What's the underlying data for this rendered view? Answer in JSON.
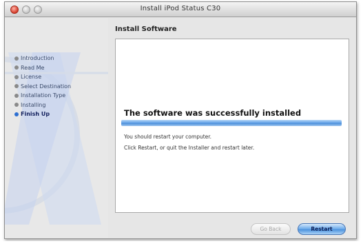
{
  "window": {
    "title": "Install iPod Status C30"
  },
  "sidebar": {
    "steps": [
      {
        "label": "Introduction",
        "state": "done"
      },
      {
        "label": "Read Me",
        "state": "done"
      },
      {
        "label": "License",
        "state": "done"
      },
      {
        "label": "Select Destination",
        "state": "done"
      },
      {
        "label": "Installation Type",
        "state": "done"
      },
      {
        "label": "Installing",
        "state": "done"
      },
      {
        "label": "Finish Up",
        "state": "current"
      }
    ]
  },
  "main": {
    "heading": "Install Software",
    "success_title": "The software was successfully installed",
    "progress_percent": 100,
    "note_line1": "You should restart your computer.",
    "note_line2": "Click Restart, or quit the Installer and restart later."
  },
  "buttons": {
    "go_back": "Go Back",
    "restart": "Restart"
  },
  "colors": {
    "accent_blue": "#4b8ed9",
    "window_bg": "#e6e6e6",
    "close_red": "#d63c2a"
  }
}
